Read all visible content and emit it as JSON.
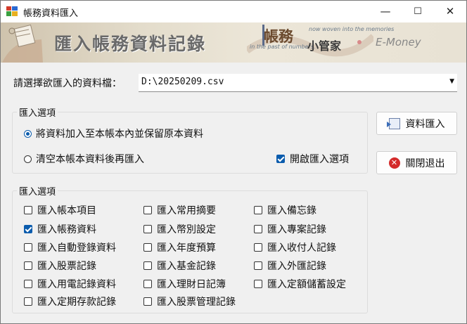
{
  "window": {
    "title": "帳務資料匯入",
    "minimize": "—",
    "maximize": "☐",
    "close": "✕"
  },
  "banner": {
    "title": "匯入帳務資料記錄",
    "logo_main": "帳務",
    "logo_sub": "小管家",
    "slogan_line1": "now woven into the memories",
    "slogan_line2": "in the past of numbers.",
    "brand": "E-Money"
  },
  "file_select": {
    "label": "請選擇欲匯入的資料檔：",
    "value": "D:\\20250209.csv"
  },
  "import_mode": {
    "title": "匯入選項",
    "options": [
      {
        "label": "將資料加入至本帳本內並保留原本資料",
        "selected": true
      },
      {
        "label": "清空本帳本資料後再匯入",
        "selected": false
      }
    ],
    "enable_options": {
      "label": "開啟匯入選項",
      "checked": true
    }
  },
  "import_items": {
    "title": "匯入選項",
    "items": [
      {
        "label": "匯入帳本項目",
        "checked": false
      },
      {
        "label": "匯入常用摘要",
        "checked": false
      },
      {
        "label": "匯入備忘錄",
        "checked": false
      },
      {
        "label": "匯入帳務資料",
        "checked": true
      },
      {
        "label": "匯入幣別設定",
        "checked": false
      },
      {
        "label": "匯入專案記錄",
        "checked": false
      },
      {
        "label": "匯入自動登錄資料",
        "checked": false
      },
      {
        "label": "匯入年度預算",
        "checked": false
      },
      {
        "label": "匯入收付人記錄",
        "checked": false
      },
      {
        "label": "匯入股票記錄",
        "checked": false
      },
      {
        "label": "匯入基金記錄",
        "checked": false
      },
      {
        "label": "匯入外匯記錄",
        "checked": false
      },
      {
        "label": "匯入用電記錄資料",
        "checked": false
      },
      {
        "label": "匯入理財日記簿",
        "checked": false
      },
      {
        "label": "匯入定額儲蓄設定",
        "checked": false
      },
      {
        "label": "匯入定期存款記錄",
        "checked": false
      },
      {
        "label": "匯入股票管理記錄",
        "checked": false
      }
    ]
  },
  "buttons": {
    "import": "資料匯入",
    "close": "關閉退出"
  },
  "colors": {
    "accent": "#0b5cad",
    "close_icon": "#d42b2b",
    "banner": "#e3dccb"
  }
}
